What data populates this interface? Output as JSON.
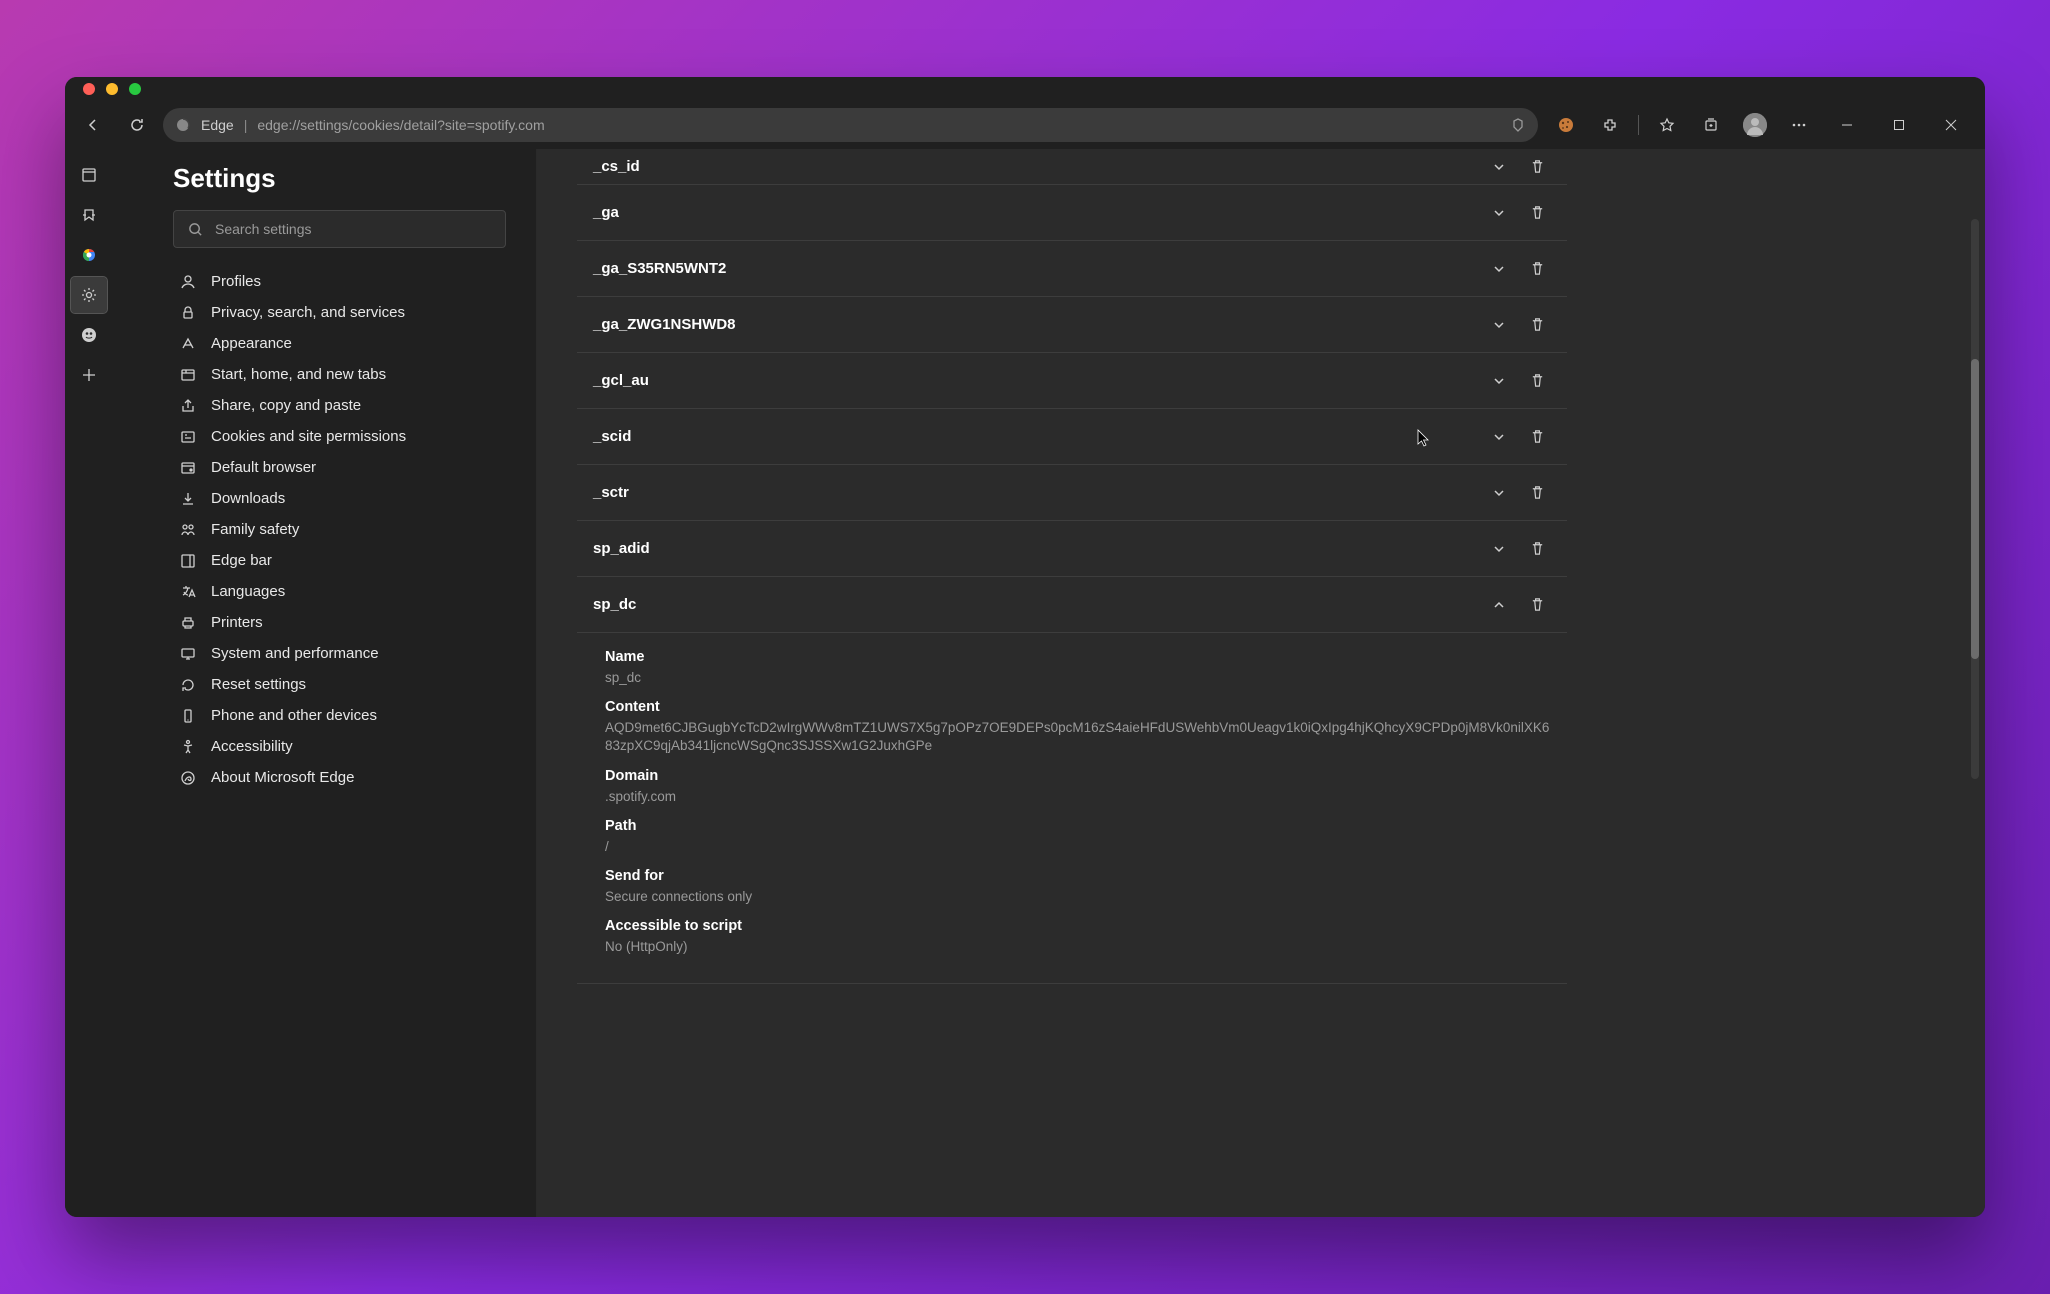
{
  "toolbar": {
    "app_label": "Edge",
    "url": "edge://settings/cookies/detail?site=spotify.com"
  },
  "sidebar": {
    "title": "Settings",
    "search_placeholder": "Search settings",
    "items": [
      {
        "label": "Profiles",
        "icon": "person"
      },
      {
        "label": "Privacy, search, and services",
        "icon": "lock"
      },
      {
        "label": "Appearance",
        "icon": "appearance"
      },
      {
        "label": "Start, home, and new tabs",
        "icon": "tabs"
      },
      {
        "label": "Share, copy and paste",
        "icon": "share"
      },
      {
        "label": "Cookies and site permissions",
        "icon": "cookie"
      },
      {
        "label": "Default browser",
        "icon": "browser"
      },
      {
        "label": "Downloads",
        "icon": "download"
      },
      {
        "label": "Family safety",
        "icon": "family"
      },
      {
        "label": "Edge bar",
        "icon": "edgebar"
      },
      {
        "label": "Languages",
        "icon": "languages"
      },
      {
        "label": "Printers",
        "icon": "printer"
      },
      {
        "label": "System and performance",
        "icon": "system"
      },
      {
        "label": "Reset settings",
        "icon": "reset"
      },
      {
        "label": "Phone and other devices",
        "icon": "phone"
      },
      {
        "label": "Accessibility",
        "icon": "accessibility"
      },
      {
        "label": "About Microsoft Edge",
        "icon": "about"
      }
    ]
  },
  "cookies": [
    {
      "name": "_cs_id",
      "expanded": false
    },
    {
      "name": "_ga",
      "expanded": false
    },
    {
      "name": "_ga_S35RN5WNT2",
      "expanded": false
    },
    {
      "name": "_ga_ZWG1NSHWD8",
      "expanded": false
    },
    {
      "name": "_gcl_au",
      "expanded": false
    },
    {
      "name": "_scid",
      "expanded": false
    },
    {
      "name": "_sctr",
      "expanded": false
    },
    {
      "name": "sp_adid",
      "expanded": false
    },
    {
      "name": "sp_dc",
      "expanded": true
    }
  ],
  "detail": {
    "labels": {
      "name": "Name",
      "content": "Content",
      "domain": "Domain",
      "path": "Path",
      "send_for": "Send for",
      "accessible": "Accessible to script"
    },
    "values": {
      "name": "sp_dc",
      "content": "AQD9met6CJBGugbYcTcD2wIrgWWv8mTZ1UWS7X5g7pOPz7OE9DEPs0pcM16zS4aieHFdUSWehbVm0Ueagv1k0iQxIpg4hjKQhcyX9CPDp0jM8Vk0nilXK683zpXC9qjAb341ljcncWSgQnc3SJSSXw1G2JuxhGPe",
      "domain": ".spotify.com",
      "path": "/",
      "send_for": "Secure connections only",
      "accessible": "No (HttpOnly)"
    }
  }
}
